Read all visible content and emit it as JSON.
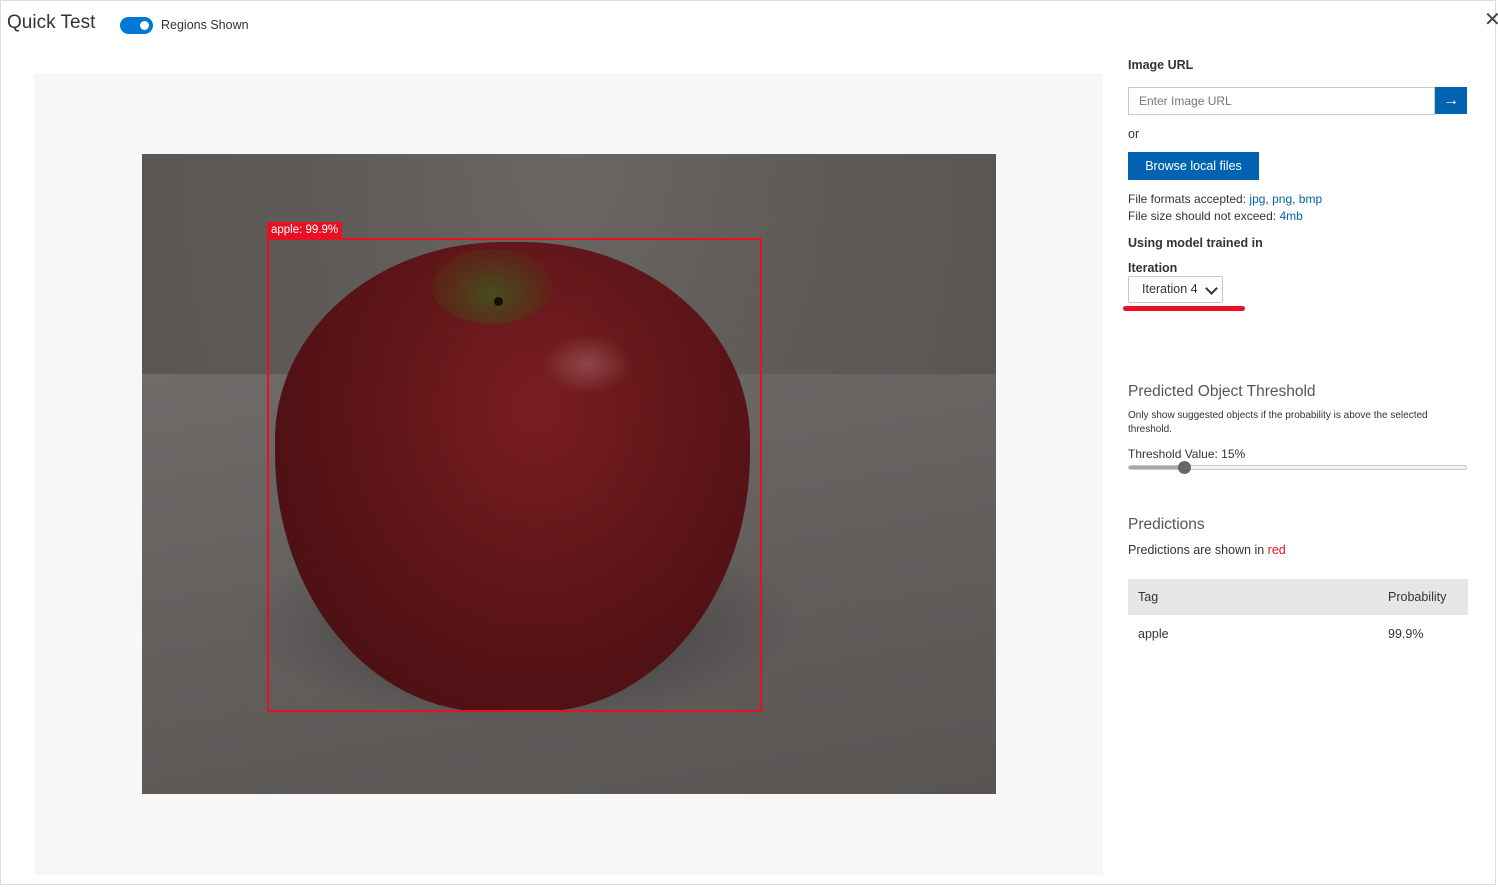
{
  "header": {
    "title": "Quick Test",
    "regions_toggle": {
      "label": "Regions Shown",
      "on": true
    },
    "close_glyph": "✕"
  },
  "preview": {
    "detection": {
      "label": "apple: 99.9%",
      "color": "#e81123"
    }
  },
  "panel": {
    "image_url": {
      "label": "Image URL",
      "placeholder": "Enter Image URL",
      "go_glyph": "→"
    },
    "or_text": "or",
    "browse_label": "Browse local files",
    "formats": {
      "prefix": "File formats accepted:",
      "items": [
        "jpg",
        "png",
        "bmp"
      ],
      "sep": ", "
    },
    "size": {
      "prefix": "File size should not exceed:",
      "value": "4mb"
    },
    "model_heading": "Using model trained in",
    "iteration": {
      "label": "Iteration",
      "selected": "Iteration 4"
    },
    "threshold": {
      "title": "Predicted Object Threshold",
      "description": "Only show suggested objects if the probability is above the selected threshold.",
      "value_label": "Threshold Value: 15%",
      "value_percent": 15
    },
    "predictions": {
      "title": "Predictions",
      "shown_prefix": "Predictions are shown in",
      "shown_color": "red",
      "columns": [
        "Tag",
        "Probability"
      ],
      "rows": [
        {
          "tag": "apple",
          "probability": "99.9%"
        }
      ]
    }
  },
  "colors": {
    "accent": "#0063b1",
    "toggle": "#0078d4",
    "highlight": "#e81123"
  }
}
